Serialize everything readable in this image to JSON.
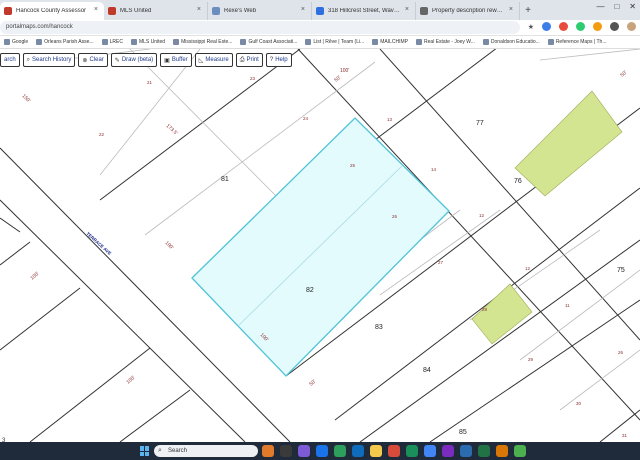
{
  "browser": {
    "tabs": [
      {
        "label": "Hancock County Assessor",
        "active": true,
        "icon_color": "#c0392b"
      },
      {
        "label": "MLS United",
        "active": false,
        "icon_color": "#c0392b"
      },
      {
        "label": "Rexe's Web",
        "active": false,
        "icon_color": "#6c8ebf"
      },
      {
        "label": "318 Hillcrest Street, Waveland",
        "active": false,
        "icon_color": "#2f6fdf"
      },
      {
        "label": "Property description rewrite",
        "active": false,
        "icon_color": "#666666"
      }
    ],
    "new_tab": "+",
    "url": "portalmaps.com/hancock",
    "window_controls": [
      "—",
      "□",
      "✕"
    ],
    "bookmarks": [
      "Google",
      "Orleans Parish Asse...",
      "LREC",
      "MLS United",
      "Mississippi Real Este...",
      "Gulf Coast Associati...",
      "List | Rêve | Team (Li...",
      "MAILCHIMP",
      "Real Estate - Joey W...",
      "Donaldson Educatio...",
      "Reference Maps | Th..."
    ]
  },
  "toolbar": {
    "buttons": [
      {
        "label": "arch",
        "icon": "none"
      },
      {
        "label": "Search History",
        "icon": "search-icon"
      },
      {
        "label": "Clear",
        "icon": "clear-icon"
      },
      {
        "label": "Draw (beta)",
        "icon": "pencil-icon"
      },
      {
        "label": "Buffer",
        "icon": "buffer-icon"
      },
      {
        "label": "Measure",
        "icon": "ruler-icon"
      },
      {
        "label": "Print",
        "icon": "printer-icon"
      },
      {
        "label": "Help",
        "icon": "help-icon"
      }
    ]
  },
  "map": {
    "street_name": "TERRACE AVE",
    "selected_parcel": "82",
    "parcel_numbers": [
      "81",
      "82",
      "83",
      "84",
      "85",
      "77",
      "76",
      "75"
    ],
    "lot_numbers": [
      "21",
      "22",
      "23",
      "24",
      "25",
      "26",
      "27",
      "28",
      "29",
      "30",
      "31",
      "13",
      "14",
      "12",
      "12",
      "11",
      "26"
    ],
    "dimensions": [
      "150'",
      "173.5'",
      "100'",
      "100'",
      "100'",
      "100'",
      "50'",
      "50'",
      "50'",
      "100'"
    ],
    "colors": {
      "selection_fill": "#e4fbfd",
      "selection_stroke": "#4fc3d6",
      "structure_fill": "#d4e592",
      "lot_number_color": "#8b2e2e",
      "street_label_color": "#1a2a8a"
    }
  },
  "taskbar": {
    "search_placeholder": "Search",
    "corner_text": "3"
  }
}
